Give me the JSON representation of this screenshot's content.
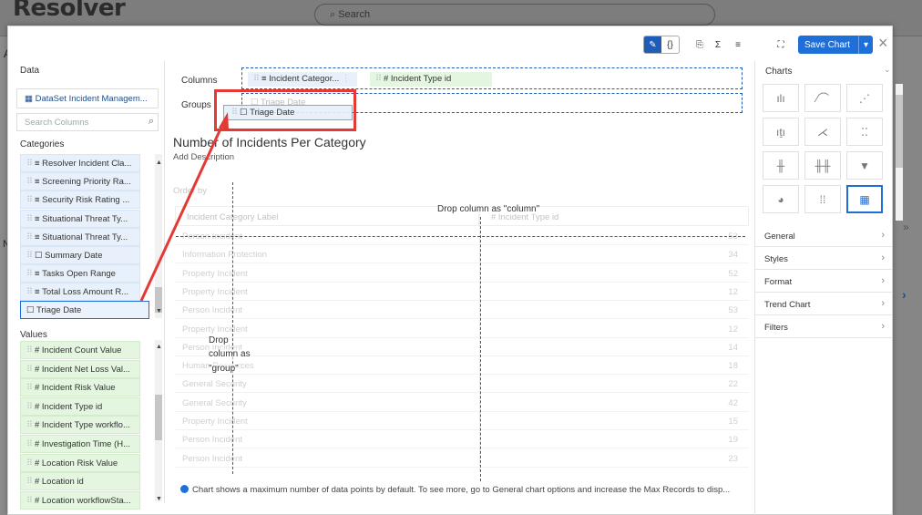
{
  "background": {
    "logo_text": "Resolver",
    "search_placeholder": "Search",
    "side_letter_a": "A",
    "side_letter_n": "N",
    "double_chevron": "»",
    "right_arrow": "›"
  },
  "toolbar": {
    "save_label": "Save Chart",
    "close_symbol": "×",
    "icons": [
      "pencil-icon",
      "code-braces-icon",
      "export-icon",
      "sigma-icon",
      "filter-icon",
      "expand-icon"
    ]
  },
  "left": {
    "data_title": "Data",
    "dataset_label": "▦ DataSet Incident Managem...",
    "search_placeholder": "Search Columns",
    "categories_title": "Categories",
    "categories": [
      "≡ Resolver Incident Cla...",
      "≡ Screening Priority Ra...",
      "≡ Security Risk Rating ...",
      "≡ Situational Threat Ty...",
      "≡ Situational Threat Ty...",
      "☐ Summary Date",
      "≡ Tasks Open Range",
      "≡ Total Loss Amount R..."
    ],
    "selected_item": "☐ Triage Date",
    "values_title": "Values",
    "values": [
      "# Incident Count Value",
      "# Incident Net Loss Val...",
      "# Incident Risk Value",
      "# Incident Type id",
      "# Incident Type workflo...",
      "# Investigation Time (H...",
      "# Location Risk Value",
      "# Location id",
      "# Location workflowSta..."
    ]
  },
  "builder": {
    "columns_label": "Columns",
    "groups_label": "Groups",
    "column_pills": [
      "≡ Incident Categor...",
      "# Incident Type id"
    ],
    "group_ghost": "☐ Triage Date",
    "dragging_label": "☐ Triage Date",
    "chart_title": "Number of Incidents Per Category",
    "add_description": "Add Description",
    "order_by": "Order by",
    "drop_column_label": "Drop column as \"column\"",
    "drop_group_label_1": "Drop",
    "drop_group_label_2": "column as",
    "drop_group_label_3": "\"group\""
  },
  "table": {
    "headers": [
      "Incident Category Label",
      "# Incident Type id"
    ],
    "rows": [
      {
        "label": "Person Incident",
        "value": "53"
      },
      {
        "label": "Information Protection",
        "value": "34"
      },
      {
        "label": "Property Incident",
        "value": "52"
      },
      {
        "label": "Property Incident",
        "value": "12"
      },
      {
        "label": "Person Incident",
        "value": "53"
      },
      {
        "label": "Property Incident",
        "value": "12"
      },
      {
        "label": "Person Incident",
        "value": "14"
      },
      {
        "label": "Human Resources",
        "value": "18"
      },
      {
        "label": "General Security",
        "value": "22"
      },
      {
        "label": "General Security",
        "value": "42"
      },
      {
        "label": "Property Incident",
        "value": "15"
      },
      {
        "label": "Person Incident",
        "value": "19"
      },
      {
        "label": "Person Incident",
        "value": "23"
      }
    ]
  },
  "footer": {
    "note": "Chart shows a maximum number of data points by default. To see more, go to General chart options and increase the Max Records to disp..."
  },
  "right": {
    "charts_title": "Charts",
    "chart_types": [
      "bar-chart-icon",
      "line-chart-icon",
      "scatter-chart-icon",
      "stacked-bar-icon",
      "area-chart-icon",
      "dot-chart-icon",
      "horizontal-bar-icon",
      "horizontal-stacked-icon",
      "funnel-icon",
      "pie-chart-icon",
      "dot-grid-icon",
      "table-icon"
    ],
    "sections": [
      "General",
      "Styles",
      "Format",
      "Trend Chart",
      "Filters"
    ]
  },
  "colors": {
    "accent": "#1f6fd8",
    "highlight": "#e53935",
    "category_bg": "#e8f1fb",
    "value_bg": "#e4f6df"
  }
}
